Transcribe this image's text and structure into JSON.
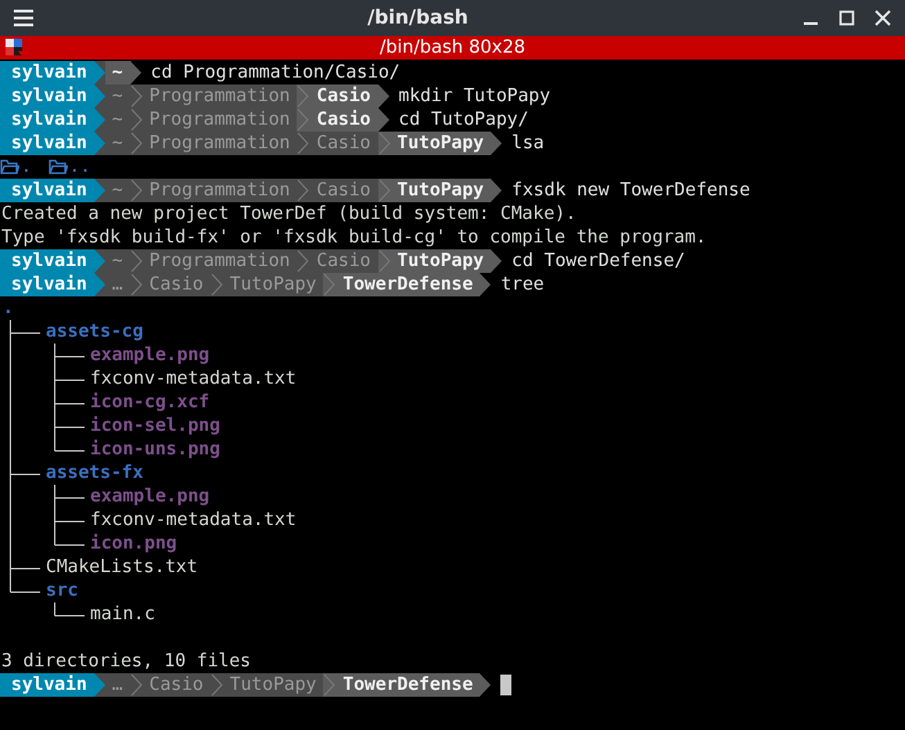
{
  "window": {
    "title": "/bin/bash"
  },
  "tab": {
    "title": "/bin/bash 80x28"
  },
  "lines": [
    {
      "kind": "prompt",
      "user": "sylvain",
      "path": [
        {
          "text": "~",
          "current": true
        }
      ],
      "command": "cd Programmation/Casio/"
    },
    {
      "kind": "prompt",
      "user": "sylvain",
      "path": [
        {
          "text": "~",
          "current": false
        },
        {
          "text": "Programmation",
          "current": false
        },
        {
          "text": "Casio",
          "current": true
        }
      ],
      "command": "mkdir TutoPapy"
    },
    {
      "kind": "prompt",
      "user": "sylvain",
      "path": [
        {
          "text": "~",
          "current": false
        },
        {
          "text": "Programmation",
          "current": false
        },
        {
          "text": "Casio",
          "current": true
        }
      ],
      "command": "cd TutoPapy/"
    },
    {
      "kind": "prompt",
      "user": "sylvain",
      "path": [
        {
          "text": "~",
          "current": false
        },
        {
          "text": "Programmation",
          "current": false
        },
        {
          "text": "Casio",
          "current": false
        },
        {
          "text": "TutoPapy",
          "current": true
        }
      ],
      "command": "lsa"
    },
    {
      "kind": "listing",
      "items": [
        {
          "name": "."
        },
        {
          "name": ".."
        }
      ]
    },
    {
      "kind": "prompt",
      "user": "sylvain",
      "path": [
        {
          "text": "~",
          "current": false
        },
        {
          "text": "Programmation",
          "current": false
        },
        {
          "text": "Casio",
          "current": false
        },
        {
          "text": "TutoPapy",
          "current": true
        }
      ],
      "command": "fxsdk new TowerDefense"
    },
    {
      "kind": "output",
      "text": "Created a new project TowerDef (build system: CMake)."
    },
    {
      "kind": "output",
      "text": "Type 'fxsdk build-fx' or 'fxsdk build-cg' to compile the program."
    },
    {
      "kind": "prompt",
      "user": "sylvain",
      "path": [
        {
          "text": "~",
          "current": false
        },
        {
          "text": "Programmation",
          "current": false
        },
        {
          "text": "Casio",
          "current": false
        },
        {
          "text": "TutoPapy",
          "current": true
        }
      ],
      "command": "cd TowerDefense/"
    },
    {
      "kind": "prompt",
      "user": "sylvain",
      "path": [
        {
          "text": "…",
          "current": false
        },
        {
          "text": "Casio",
          "current": false
        },
        {
          "text": "TutoPapy",
          "current": false
        },
        {
          "text": "TowerDefense",
          "current": true
        }
      ],
      "command": "tree"
    },
    {
      "kind": "tree",
      "root": ".",
      "children": [
        {
          "name": "assets-cg",
          "kind": "dir",
          "children": [
            {
              "name": "example.png",
              "kind": "image"
            },
            {
              "name": "fxconv-metadata.txt",
              "kind": "file"
            },
            {
              "name": "icon-cg.xcf",
              "kind": "image"
            },
            {
              "name": "icon-sel.png",
              "kind": "image"
            },
            {
              "name": "icon-uns.png",
              "kind": "image"
            }
          ]
        },
        {
          "name": "assets-fx",
          "kind": "dir",
          "children": [
            {
              "name": "example.png",
              "kind": "image"
            },
            {
              "name": "fxconv-metadata.txt",
              "kind": "file"
            },
            {
              "name": "icon.png",
              "kind": "image"
            }
          ]
        },
        {
          "name": "CMakeLists.txt",
          "kind": "file"
        },
        {
          "name": "src",
          "kind": "dir",
          "children": [
            {
              "name": "main.c",
              "kind": "file"
            }
          ]
        }
      ]
    },
    {
      "kind": "blank"
    },
    {
      "kind": "output",
      "text": "3 directories, 10 files"
    },
    {
      "kind": "prompt",
      "user": "sylvain",
      "path": [
        {
          "text": "…",
          "current": false
        },
        {
          "text": "Casio",
          "current": false
        },
        {
          "text": "TutoPapy",
          "current": false
        },
        {
          "text": "TowerDefense",
          "current": true
        }
      ],
      "cursor": true
    }
  ]
}
